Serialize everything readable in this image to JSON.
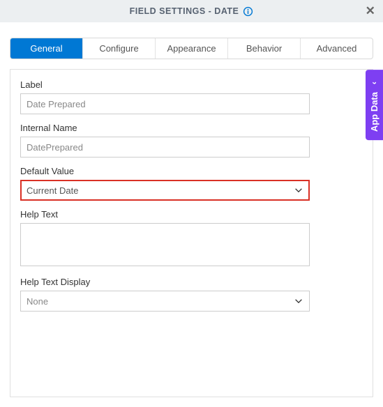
{
  "header": {
    "title": "FIELD SETTINGS - DATE"
  },
  "tabs": {
    "items": [
      {
        "label": "General"
      },
      {
        "label": "Configure"
      },
      {
        "label": "Appearance"
      },
      {
        "label": "Behavior"
      },
      {
        "label": "Advanced"
      }
    ]
  },
  "form": {
    "label": {
      "label": "Label",
      "value": "Date Prepared"
    },
    "internalName": {
      "label": "Internal Name",
      "value": "DatePrepared"
    },
    "defaultValue": {
      "label": "Default Value",
      "value": "Current Date"
    },
    "helpText": {
      "label": "Help Text",
      "value": ""
    },
    "helpTextDisplay": {
      "label": "Help Text Display",
      "value": "None"
    }
  },
  "sidebar": {
    "label": "App Data"
  }
}
